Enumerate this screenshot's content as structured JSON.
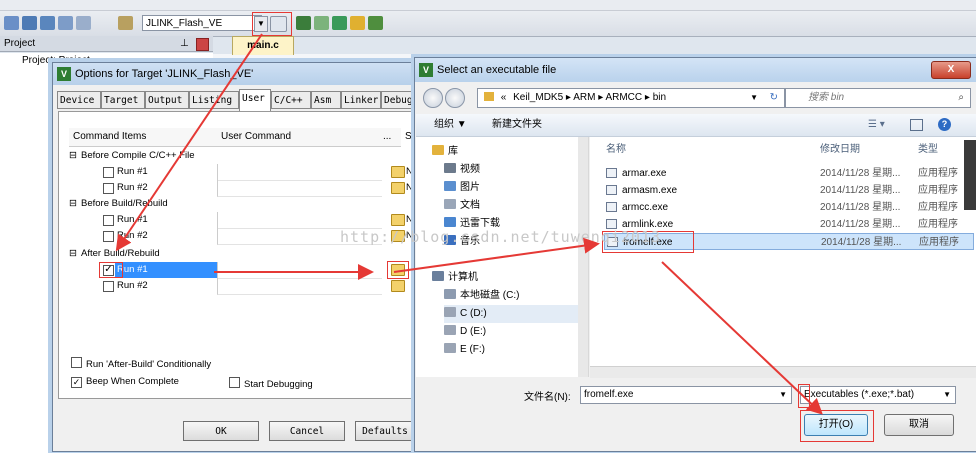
{
  "ide": {
    "target_name": "JLINK_Flash_VE",
    "project_label": "Project",
    "project_tree_root": "Project: Project",
    "editor_tab": "main.c"
  },
  "options_dialog": {
    "title": "Options for Target 'JLINK_Flash_VE'",
    "tabs": [
      "Device",
      "Target",
      "Output",
      "Listing",
      "User",
      "C/C++",
      "Asm",
      "Linker",
      "Debug"
    ],
    "active_tab": "User",
    "columns": {
      "items": "Command Items",
      "command": "User Command",
      "dots": "...",
      "stop": "St"
    },
    "groups": [
      {
        "label": "Before Compile C/C++ File",
        "rows": [
          {
            "label": "Run #1",
            "checked": false,
            "no": ""
          },
          {
            "label": "Run #2",
            "checked": false,
            "no": ""
          }
        ]
      },
      {
        "label": "Before Build/Rebuild",
        "rows": [
          {
            "label": "Run #1",
            "checked": false,
            "no": ""
          },
          {
            "label": "Run #2",
            "checked": false,
            "no": ""
          }
        ]
      },
      {
        "label": "After Build/Rebuild",
        "rows": [
          {
            "label": "Run #1",
            "checked": true,
            "no": ""
          },
          {
            "label": "Run #2",
            "checked": false,
            "no": ""
          }
        ]
      }
    ],
    "no_text": "No",
    "option_run_after_build": "Run 'After-Build' Conditionally",
    "option_beep": "Beep When Complete",
    "option_start_debug": "Start Debugging",
    "btn_ok": "OK",
    "btn_cancel": "Cancel",
    "btn_defaults": "Defaults"
  },
  "file_dialog": {
    "title": "Select an executable file",
    "close": "X",
    "path": [
      "Keil_MDK5",
      "ARM",
      "ARMCC",
      "bin"
    ],
    "path_prefix": "«",
    "search_placeholder": "搜索 bin",
    "organize": "组织 ▼",
    "new_folder": "新建文件夹",
    "col_name": "名称",
    "col_date": "修改日期",
    "col_type": "类型",
    "nav_items": [
      {
        "label": "库",
        "color": "#e3b23c"
      },
      {
        "label": "视频",
        "color": "#6c7a8c"
      },
      {
        "label": "图片",
        "color": "#5b8fcf"
      },
      {
        "label": "文档",
        "color": "#9aa6b8"
      },
      {
        "label": "迅雷下载",
        "color": "#4a86d0"
      },
      {
        "label": "音乐",
        "color": "#3a6fbf"
      },
      {
        "label": "计算机",
        "color": "#6a7f9c"
      },
      {
        "label": "本地磁盘 (C:)",
        "color": "#8d9bb0"
      },
      {
        "label": "C (D:)",
        "color": "#9aa4b4"
      },
      {
        "label": "D (E:)",
        "color": "#9aa4b4"
      },
      {
        "label": "E (F:)",
        "color": "#9aa4b4"
      }
    ],
    "files": [
      {
        "name": "armar.exe",
        "date": "2014/11/28 星期...",
        "type": "应用程序"
      },
      {
        "name": "armasm.exe",
        "date": "2014/11/28 星期...",
        "type": "应用程序"
      },
      {
        "name": "armcc.exe",
        "date": "2014/11/28 星期...",
        "type": "应用程序"
      },
      {
        "name": "armlink.exe",
        "date": "2014/11/28 星期...",
        "type": "应用程序"
      },
      {
        "name": "fromelf.exe",
        "date": "2014/11/28 星期...",
        "type": "应用程序"
      }
    ],
    "selected_file": "fromelf.exe",
    "filename_label": "文件名(N):",
    "filename_value": "fromelf.exe",
    "filetype_value": "Executables (*.exe;*.bat)",
    "btn_open": "打开(O)",
    "btn_cancel": "取消"
  },
  "watermark": "http://blog.csdn.net/tuwenqi2013"
}
